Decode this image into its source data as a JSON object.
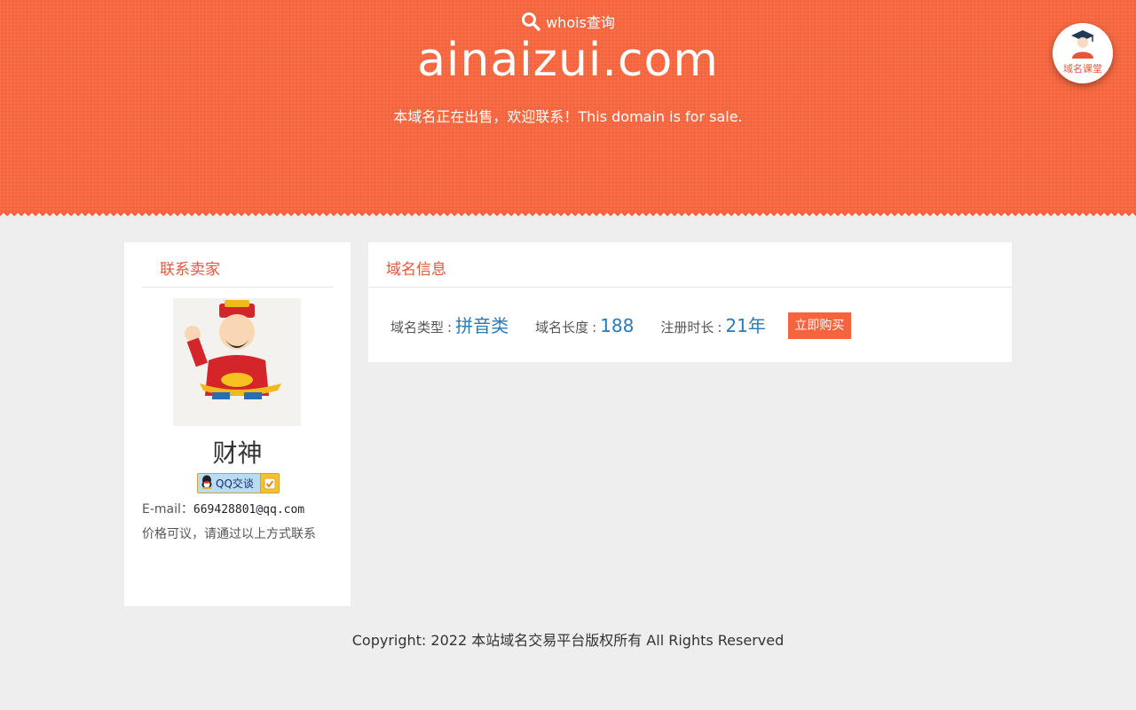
{
  "header": {
    "whois_label": "whois查询",
    "domain": "ainaizui.com",
    "sale_text": "本域名正在出售，欢迎联系！This domain is for sale.",
    "badge_label": "域名课堂"
  },
  "owner": {
    "panel_title": "联系卖家",
    "name": "财神",
    "qq_label": "QQ交谈",
    "email_label": "E-mail：",
    "email": "669428801@qq.com",
    "note": "价格可议，请通过以上方式联系"
  },
  "domain_info": {
    "panel_title": "域名信息",
    "items": [
      {
        "label": "域名类型",
        "value": "拼音类"
      },
      {
        "label": "域名长度",
        "value": "188"
      },
      {
        "label": "注册时长",
        "value": "21年"
      }
    ],
    "buy_label": "立即购买"
  },
  "footer": {
    "copyright": "Copyright: 2022 本站域名交易平台版权所有 All Rights Reserved"
  },
  "colors": {
    "accent": "#f5643c",
    "title_text": "#e8553a",
    "value_text": "#2a7ab8",
    "background": "#eeeeee"
  }
}
